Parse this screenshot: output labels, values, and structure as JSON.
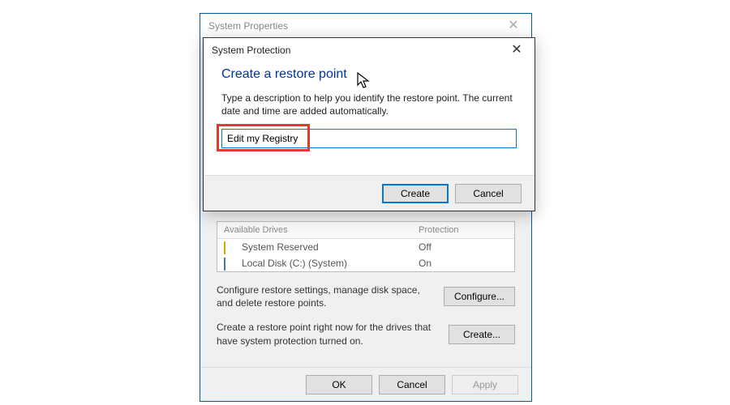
{
  "parent_window": {
    "title": "System Properties",
    "drives": {
      "col_drive": "Available Drives",
      "col_protection": "Protection",
      "rows": [
        {
          "name": "System Reserved",
          "protection": "Off",
          "icon": "folder"
        },
        {
          "name": "Local Disk (C:) (System)",
          "protection": "On",
          "icon": "disk"
        }
      ]
    },
    "configure_text": "Configure restore settings, manage disk space, and delete restore points.",
    "configure_button": "Configure...",
    "create_text": "Create a restore point right now for the drives that have system protection turned on.",
    "create_button": "Create...",
    "footer": {
      "ok": "OK",
      "cancel": "Cancel",
      "apply": "Apply"
    }
  },
  "child_dialog": {
    "title": "System Protection",
    "heading": "Create a restore point",
    "description": "Type a description to help you identify the restore point. The current date and time are added automatically.",
    "input_value": "Edit my Registry",
    "footer": {
      "create": "Create",
      "cancel": "Cancel"
    }
  }
}
